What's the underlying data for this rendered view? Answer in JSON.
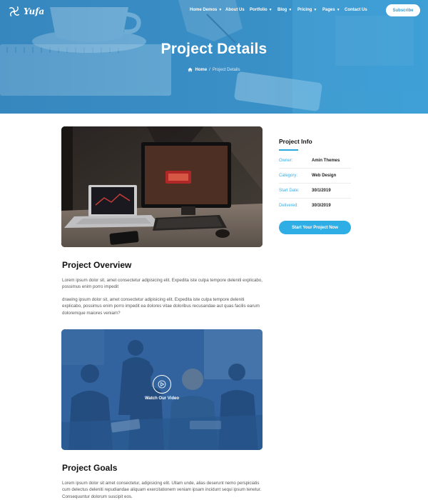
{
  "brand": {
    "name": "Yufa"
  },
  "nav": {
    "items": [
      {
        "label": "Home Demos",
        "has_dropdown": true
      },
      {
        "label": "About Us",
        "has_dropdown": false
      },
      {
        "label": "Portfolio",
        "has_dropdown": true
      },
      {
        "label": "Blog",
        "has_dropdown": true
      },
      {
        "label": "Pricing",
        "has_dropdown": true
      },
      {
        "label": "Pages",
        "has_dropdown": true
      },
      {
        "label": "Contact Us",
        "has_dropdown": false
      }
    ],
    "subscribe_label": "Subscribe"
  },
  "hero": {
    "title": "Project Details",
    "breadcrumb": {
      "home": "Home",
      "separator": "/",
      "current": "Project Details"
    }
  },
  "main": {
    "overview_title": "Project Overview",
    "overview_paragraphs": [
      "Lorem ipsum dolor sit, amet consectetur adipisicing elit. Expedita iste culpa tempore deleniti explicabo, possimus enim porro impedit",
      "drawing ipsum dolor sit, amet consectetur adipisicing elit. Expedita iste culpa tempore deleniti explicabo, possimus enim porro impedit ea dolores vitae doloribus recusandae aut quas facilis earum doloremque maiores veniam?"
    ],
    "video_label": "Watch Our Video",
    "goals_title": "Project Goals",
    "goals_paragraph": "Lorem ipsum dolor sit amet consectetur, adipisicing elit. Ullam unde, alias deserunt nemo perspiciatis cum delectus deleniti repudiandae aliquam exercitationem veniam ipsam incidunt sequi ipsum tenetur. Consequuntur dolorum suscipit eos."
  },
  "sidebar": {
    "title": "Project Info",
    "rows": [
      {
        "key": "Owner:",
        "value": "Amin Themes"
      },
      {
        "key": "Category:",
        "value": "Web Design"
      },
      {
        "key": "Start Date:",
        "value": "30/1/2019"
      },
      {
        "key": "Delivered:",
        "value": "30/3/2019"
      }
    ],
    "cta_label": "Start Your Project Now"
  },
  "colors": {
    "accent": "#2faee6",
    "hero_blue": "#3a9fd6",
    "heading": "#111111",
    "body_text": "#555555"
  },
  "icons": [
    "yufa-logo-icon",
    "chevron-down-icon",
    "home-icon",
    "play-icon"
  ]
}
